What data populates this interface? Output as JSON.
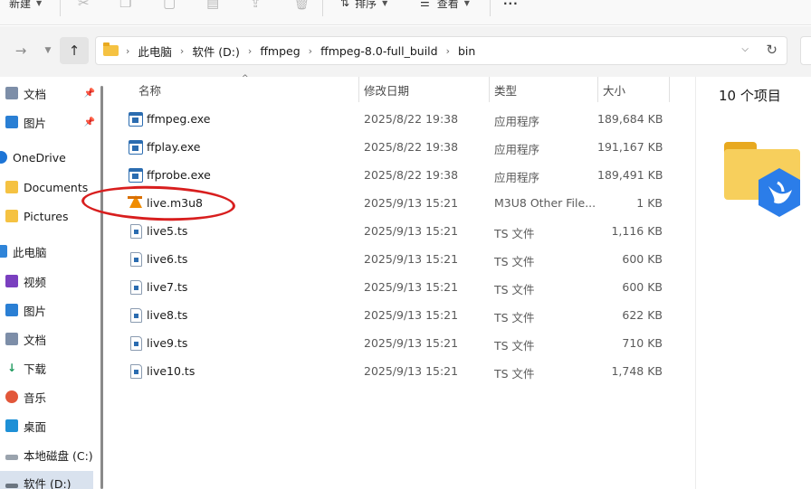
{
  "toolbar": {
    "new_label": "新建",
    "sort_label": "排序",
    "view_label": "查看",
    "more_label": "···"
  },
  "address": {
    "crumbs": [
      "此电脑",
      "软件 (D:)",
      "ffmpeg",
      "ffmpeg-8.0-full_build",
      "bin"
    ]
  },
  "sidebar": {
    "items": [
      {
        "label": "文档",
        "icon": "documents-icon",
        "pinned": true
      },
      {
        "label": "图片",
        "icon": "pictures-icon",
        "pinned": true
      },
      {
        "label": "OneDrive",
        "icon": "onedrive-icon"
      },
      {
        "label": "Documents",
        "icon": "folder-icon"
      },
      {
        "label": "Pictures",
        "icon": "folder-icon"
      },
      {
        "label": "此电脑",
        "icon": "computer-icon"
      },
      {
        "label": "视频",
        "icon": "videos-icon"
      },
      {
        "label": "图片",
        "icon": "pictures-icon"
      },
      {
        "label": "文档",
        "icon": "documents-icon"
      },
      {
        "label": "下载",
        "icon": "downloads-icon"
      },
      {
        "label": "音乐",
        "icon": "music-icon"
      },
      {
        "label": "桌面",
        "icon": "desktop-icon"
      },
      {
        "label": "本地磁盘 (C:)",
        "icon": "drive-icon"
      },
      {
        "label": "软件 (D:)",
        "icon": "drive-icon",
        "selected": true
      }
    ]
  },
  "columns": {
    "name": "名称",
    "date": "修改日期",
    "type": "类型",
    "size": "大小"
  },
  "files": [
    {
      "name": "ffmpeg.exe",
      "date": "2025/8/22 19:38",
      "type": "应用程序",
      "size": "189,684 KB",
      "icon": "exe-icon"
    },
    {
      "name": "ffplay.exe",
      "date": "2025/8/22 19:38",
      "type": "应用程序",
      "size": "191,167 KB",
      "icon": "exe-icon"
    },
    {
      "name": "ffprobe.exe",
      "date": "2025/8/22 19:38",
      "type": "应用程序",
      "size": "189,491 KB",
      "icon": "exe-icon"
    },
    {
      "name": "live.m3u8",
      "date": "2025/9/13 15:21",
      "type": "M3U8 Other File...",
      "size": "1 KB",
      "icon": "vlc-cone-icon"
    },
    {
      "name": "live5.ts",
      "date": "2025/9/13 15:21",
      "type": "TS 文件",
      "size": "1,116 KB",
      "icon": "file-icon"
    },
    {
      "name": "live6.ts",
      "date": "2025/9/13 15:21",
      "type": "TS 文件",
      "size": "600 KB",
      "icon": "file-icon"
    },
    {
      "name": "live7.ts",
      "date": "2025/9/13 15:21",
      "type": "TS 文件",
      "size": "600 KB",
      "icon": "file-icon"
    },
    {
      "name": "live8.ts",
      "date": "2025/9/13 15:21",
      "type": "TS 文件",
      "size": "622 KB",
      "icon": "file-icon"
    },
    {
      "name": "live9.ts",
      "date": "2025/9/13 15:21",
      "type": "TS 文件",
      "size": "710 KB",
      "icon": "file-icon"
    },
    {
      "name": "live10.ts",
      "date": "2025/9/13 15:21",
      "type": "TS 文件",
      "size": "1,748 KB",
      "icon": "file-icon"
    }
  ],
  "details": {
    "item_count": "10 个项目"
  },
  "colors": {
    "accent": "#2b6cb0",
    "folder": "#f7cf5c",
    "highlight": "#d81e1e",
    "selected_nav": "#d9e2ee"
  }
}
